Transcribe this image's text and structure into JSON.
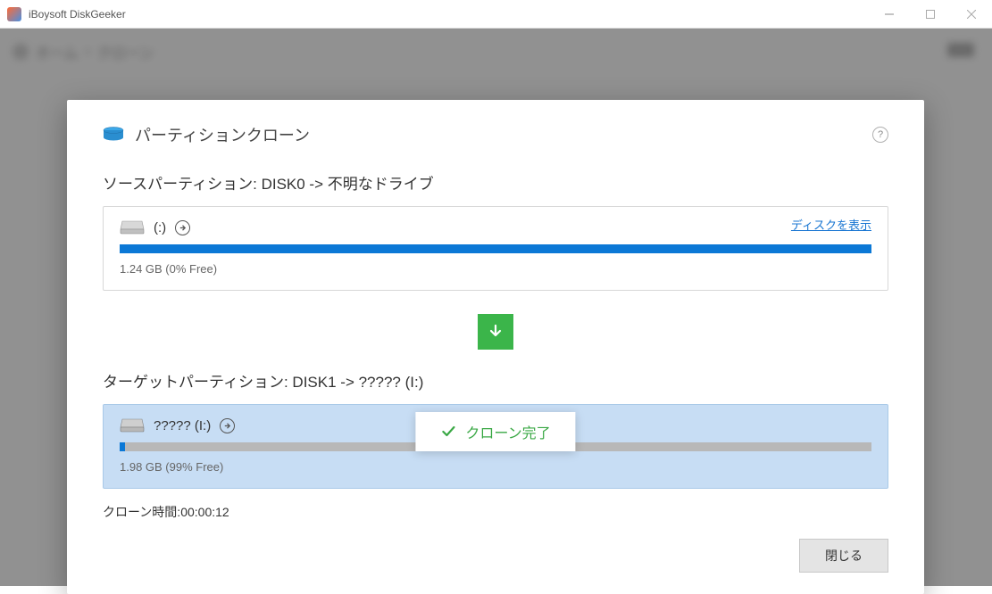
{
  "window": {
    "title": "iBoysoft DiskGeeker"
  },
  "breadcrumb": {
    "home": "ホーム",
    "sep": "›",
    "current": "クローン"
  },
  "modal": {
    "title": "パーティションクローン",
    "help": "?",
    "source": {
      "label": "ソースパーティション: DISK0 -> 不明なドライブ",
      "show_disk": "ディスクを表示",
      "name": "(:)",
      "size_text": "1.24 GB (0% Free)",
      "fill_percent": 100
    },
    "target": {
      "label": "ターゲットパーティション: DISK1 -> ????? (I:)",
      "name": "????? (I:)",
      "size_text": "1.98 GB (99% Free)",
      "fill_percent": 1
    },
    "toast": "クローン完了",
    "clone_time_label": "クローン時間:",
    "clone_time_value": "00:00:12",
    "close_label": "閉じる"
  },
  "colors": {
    "accent_blue": "#0b78d6",
    "green": "#3bb54a",
    "target_bg": "#c7ddf4"
  }
}
